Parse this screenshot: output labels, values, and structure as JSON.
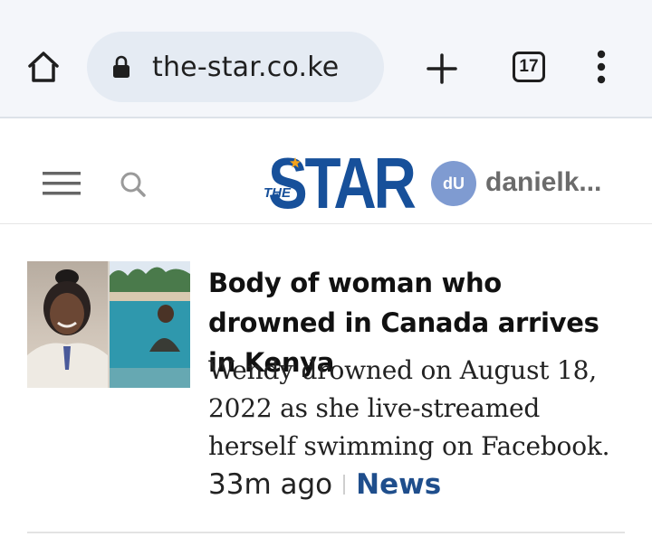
{
  "browser": {
    "url": "the-star.co.ke",
    "tab_count": "17",
    "icons": [
      "home-icon",
      "lock-icon",
      "plus-icon",
      "tabs-icon",
      "more-vert-icon"
    ]
  },
  "site": {
    "logo_the": "THE",
    "logo_star": "STAR",
    "user_initials": "dU",
    "username": "danielk...",
    "brand_color": "#17509a",
    "avatar_color": "#7f9bd1",
    "icons": [
      "menu-icon",
      "search-icon"
    ]
  },
  "article": {
    "headline": "Body of woman who drowned in Canada arrives in Kenya",
    "summary": "Wendy drowned on August 18, 2022 as she live-streamed herself swimming on Facebook.",
    "time": "33m ago",
    "category": "News",
    "category_color": "#1f4e8c"
  }
}
